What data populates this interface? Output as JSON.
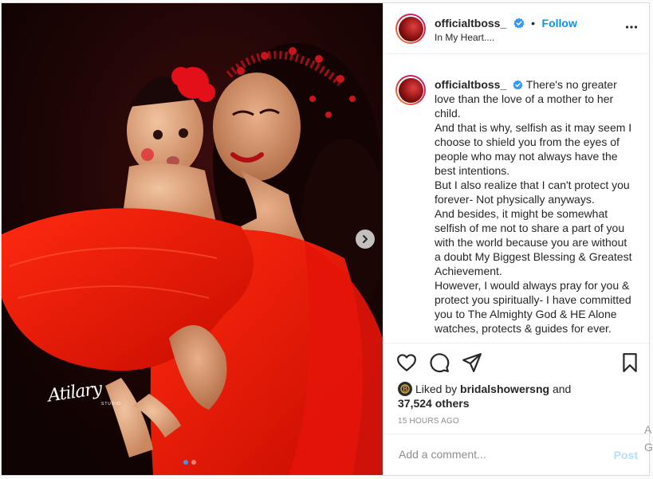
{
  "post": {
    "username": "officialtboss_",
    "separator": "•",
    "follow_label": "Follow",
    "location": "In My Heart....",
    "more_icon": "more-options-icon",
    "verified_icon": "verified-badge-icon",
    "image": {
      "watermark": "Atilary",
      "watermark_sub": "STUDIO",
      "carousel_dots": 2,
      "active_dot": 1,
      "next_icon": "chevron-right-icon"
    },
    "caption": {
      "username": "officialtboss_",
      "paragraphs": [
        "There's no greater love than the love of a mother to her child.",
        "And that is why, selfish as it may seem I choose to shield you from the eyes of people who may not always have the best intentions.",
        "But I also realize that I can't protect you forever- Not physically anyways.",
        "And besides, it might be somewhat selfish of me not to share a part of you with the world because you are without a doubt My Biggest Blessing & Greatest Achievement.",
        "However, I would always pray for you & protect you spiritually- I have committed you to The Almighty God & HE Alone watches, protects & guides for ever."
      ]
    },
    "actions": {
      "like_icon": "heart-icon",
      "comment_icon": "comment-bubble-icon",
      "share_icon": "share-paper-plane-icon",
      "save_icon": "bookmark-icon"
    },
    "likes": {
      "prefix": "Liked by",
      "user": "bridalshowersng",
      "and": "and",
      "others": "37,524 others"
    },
    "timestamp": "15 HOURS AGO",
    "comment_box": {
      "placeholder": "Add a comment...",
      "post_label": "Post"
    }
  },
  "edge_fragment": [
    "A",
    "G"
  ],
  "colors": {
    "link_blue": "#0095f6",
    "post_disabled": "#b2dffc",
    "border": "#dbdbdb",
    "muted": "#8e8e8e"
  }
}
